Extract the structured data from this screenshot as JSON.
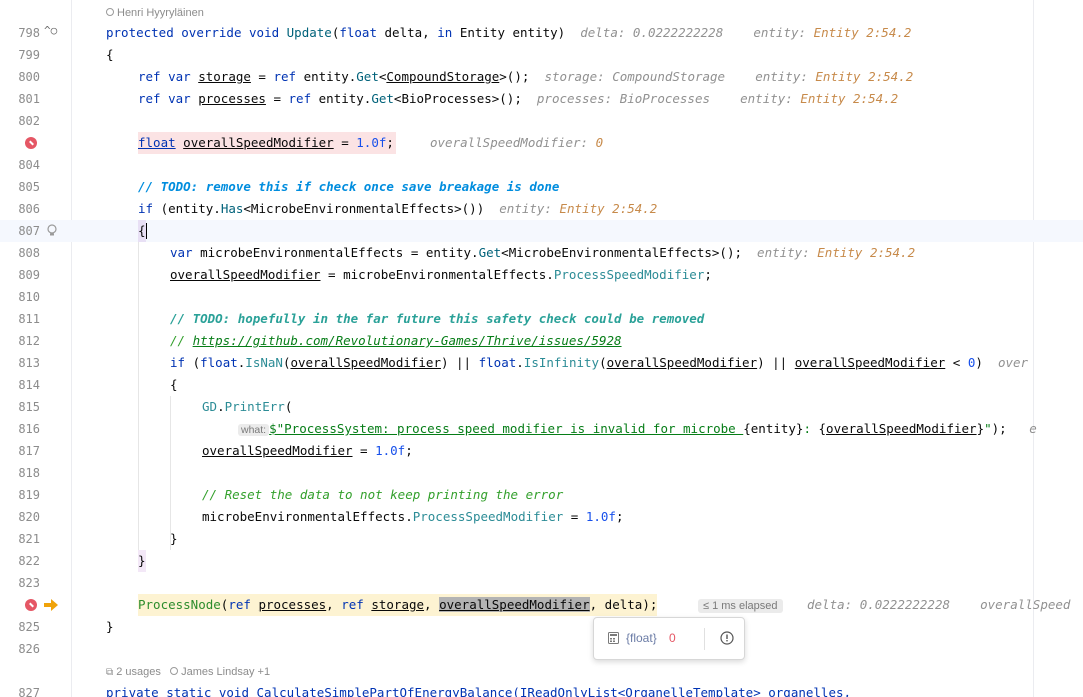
{
  "meta": {
    "author_top": "Henri Hyyryläinen",
    "usages": "2 usages",
    "author_bottom": "James Lindsay +1"
  },
  "lines": {
    "l798": "798",
    "l799": "799",
    "l800": "800",
    "l801": "801",
    "l802": "802",
    "l804": "804",
    "l805": "805",
    "l806": "806",
    "l807": "807",
    "l808": "808",
    "l809": "809",
    "l810": "810",
    "l811": "811",
    "l812": "812",
    "l813": "813",
    "l814": "814",
    "l815": "815",
    "l816": "816",
    "l817": "817",
    "l818": "818",
    "l819": "819",
    "l820": "820",
    "l821": "821",
    "l822": "822",
    "l823": "823",
    "l825": "825",
    "l826": "826",
    "l827": "827"
  },
  "code": {
    "kw_protected": "protected",
    "kw_override": "override",
    "kw_void": "void",
    "fn_update": "Update",
    "kw_float": "float",
    "p_delta": "delta",
    "kw_in": "in",
    "ty_entity": "Entity",
    "p_entity": "entity",
    "brace_open": "{",
    "brace_close": "}",
    "kw_ref": "ref",
    "kw_var": "var",
    "v_storage": "storage",
    "v_entity": "entity",
    "fn_get": "Get",
    "ty_compound": "CompoundStorage",
    "ty_bio": "BioProcesses",
    "v_processes": "processes",
    "v_osm": "overallSpeedModifier",
    "num_one": "1.0f",
    "todo1": "// TODO: remove this if check once save breakage is done",
    "kw_if": "if",
    "fn_has": "Has",
    "ty_mee": "MicrobeEnvironmentalEffects",
    "v_mee": "microbeEnvironmentalEffects",
    "prop_psm": "ProcessSpeedModifier",
    "todo2": "// TODO: hopefully in the far future this safety check could be removed",
    "cmt_slashes": "// ",
    "url": "https://github.com/Revolutionary-Games/Thrive/issues/5928",
    "fn_isnan": "IsNaN",
    "fn_isinf": "IsInfinity",
    "num_zero": "0",
    "gd": "GD",
    "fn_printerr": "PrintErr",
    "param_what": "what:",
    "str_prefix": "$\"ProcessSystem: process speed modifier is invalid for microbe ",
    "str_colon": ": ",
    "cmt_reset": "// Reset the data to not keep printing the error",
    "fn_processnode": "ProcessNode",
    "l827_code": "private static void CalculateSimplePartOfEnergyBalance(IReadOnlyList<OrganelleTemplate> organelles,"
  },
  "hints": {
    "delta_label": "delta:",
    "delta_val": "0.0222222228",
    "entity_label": "entity:",
    "entity_val": "Entity 2:54.2",
    "storage_label": "storage:",
    "storage_val": "CompoundStorage",
    "processes_label": "processes:",
    "processes_val": "BioProcesses",
    "osm_label": "overallSpeedModifier:",
    "osm_val": "0",
    "over_trunc": "over",
    "e_trunc": "e",
    "elapsed": "≤ 1 ms elapsed",
    "overall_trunc": "overallSpeed"
  },
  "popup": {
    "type": "{float}",
    "value": "0"
  },
  "colors": {
    "breakpoint": "#e55765",
    "exec_arrow": "#f0a30a",
    "keyword": "#0033b3"
  }
}
